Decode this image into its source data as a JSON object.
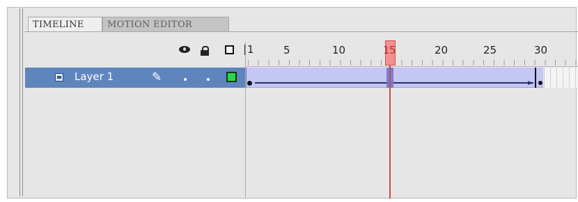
{
  "tabs": [
    {
      "label": "TIMELINE",
      "active": true
    },
    {
      "label": "MOTION EDITOR",
      "active": false
    }
  ],
  "header_icons": [
    "eye-icon",
    "lock-icon",
    "outline-icon"
  ],
  "ruler": {
    "first_label": "1",
    "labels": [
      "5",
      "10",
      "15",
      "20",
      "25",
      "30"
    ],
    "current_frame": 15
  },
  "layer": {
    "name": "Layer 1",
    "icon": "layer-icon",
    "edit_icon": "pencil-icon",
    "outline_color": "#2fd44d",
    "tween_start_frame": 1,
    "tween_end_frame": 29
  },
  "colors": {
    "selected_row": "#5f85bd",
    "tween_span": "#c4c6f4",
    "playhead": "#d34646"
  }
}
